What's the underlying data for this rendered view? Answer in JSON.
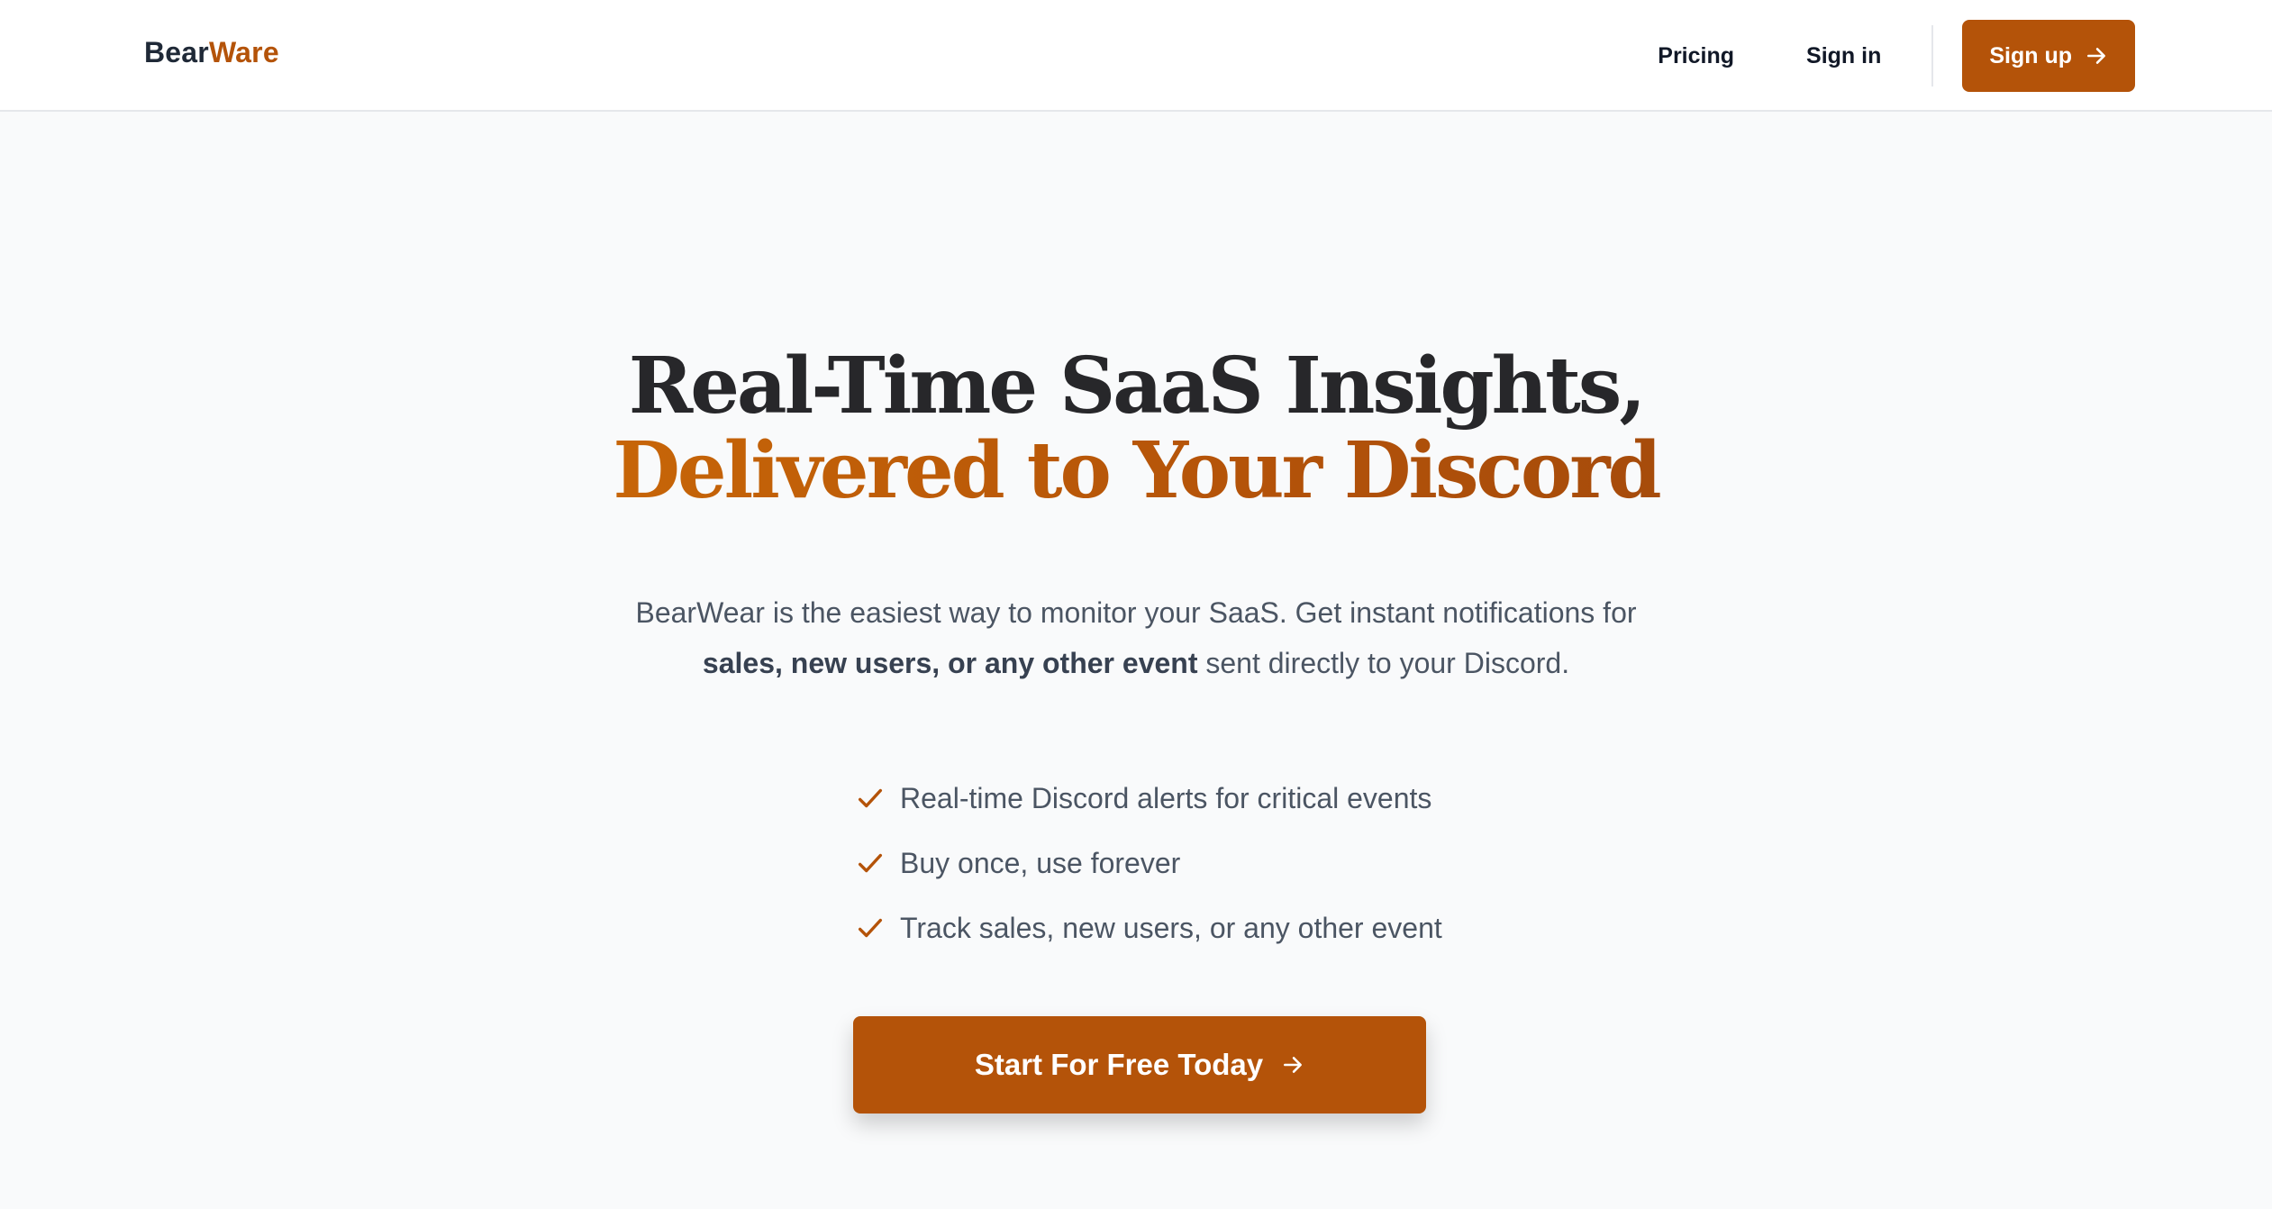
{
  "nav": {
    "logo_part1": "Bear",
    "logo_part2": "Ware",
    "links": [
      {
        "label": "Pricing"
      },
      {
        "label": "Sign in"
      }
    ],
    "signup_label": "Sign up",
    "signup_icon": "arrow-right-icon"
  },
  "hero": {
    "headline_line1": "Real-Time SaaS Insights,",
    "headline_line2": "Delivered to Your Discord",
    "description_part1": "BearWear is the easiest way to monitor your SaaS. Get instant notifications for",
    "description_bold": "sales, new users, or any other event",
    "description_part2": " sent directly to your Discord.",
    "features": [
      {
        "text": "Real-time Discord alerts for critical events",
        "icon": "check-icon"
      },
      {
        "text": "Buy once, use forever",
        "icon": "check-icon"
      },
      {
        "text": "Track sales, new users, or any other event",
        "icon": "check-icon"
      }
    ],
    "cta_label": "Start For Free Today",
    "cta_icon": "arrow-right-icon"
  },
  "colors": {
    "accent": "#b45309",
    "gradient_start": "#d97706",
    "gradient_end": "#92400e",
    "heading": "#27272a",
    "body_text": "#4b5563",
    "background": "#f9fafb"
  }
}
